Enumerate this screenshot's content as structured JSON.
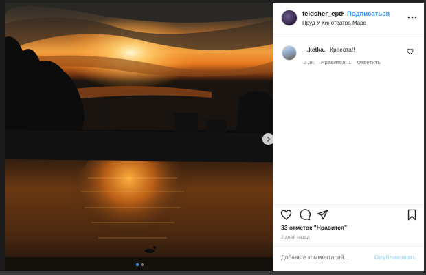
{
  "post": {
    "username": "feldsher_epti",
    "separator": "•",
    "follow_label": "Подписаться",
    "location": "Пруд У Кинотеатра Марс",
    "more_icon": "more-horizontal-icon"
  },
  "comments": [
    {
      "username": "_.ketka._",
      "text": "Красота!!",
      "time": "2 дн.",
      "likes": "Нравится: 1",
      "reply": "Ответить"
    }
  ],
  "stats": {
    "likes": "33 отметок \"Нравится\"",
    "posted": "2 дней назад"
  },
  "composer": {
    "placeholder": "Добавьте комментарий...",
    "publish_label": "Опубликовать"
  },
  "colors": {
    "accent": "#3897f0",
    "publish_disabled": "#b2dffc",
    "muted": "#8e8e8e",
    "text": "#262626"
  }
}
